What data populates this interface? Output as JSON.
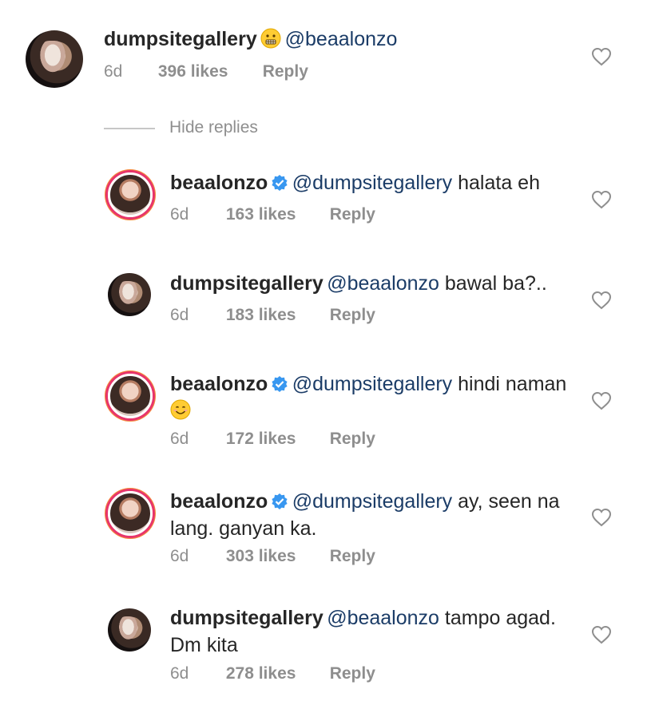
{
  "top_comment": {
    "username": "dumpsitegallery",
    "mention": "@beaalonzo",
    "emoji": "grimacing-face",
    "time": "6d",
    "likes": "396 likes",
    "reply": "Reply"
  },
  "hide_replies_label": "Hide replies",
  "replies": [
    {
      "username": "beaalonzo",
      "verified": true,
      "mention": "@dumpsitegallery",
      "text": " halata eh",
      "time": "6d",
      "likes": "163 likes",
      "reply": "Reply"
    },
    {
      "username": "dumpsitegallery",
      "verified": false,
      "mention": "@beaalonzo",
      "text": " bawal ba?..",
      "time": "6d",
      "likes": "183 likes",
      "reply": "Reply"
    },
    {
      "username": "beaalonzo",
      "verified": true,
      "mention": "@dumpsitegallery",
      "text": " hindi naman",
      "emoji": "smiling-face",
      "time": "6d",
      "likes": "172 likes",
      "reply": "Reply"
    },
    {
      "username": "beaalonzo",
      "verified": true,
      "mention": "@dumpsitegallery",
      "text": " ay, seen na lang. ganyan ka.",
      "time": "6d",
      "likes": "303 likes",
      "reply": "Reply"
    },
    {
      "username": "dumpsitegallery",
      "verified": false,
      "mention": "@beaalonzo",
      "text": " tampo agad. Dm kita",
      "time": "6d",
      "likes": "278 likes",
      "reply": "Reply"
    }
  ],
  "colors": {
    "mention": "#1b3c67",
    "meta": "#8e8e8e",
    "verified": "#3897f0",
    "story_ring": "#e7356c"
  }
}
